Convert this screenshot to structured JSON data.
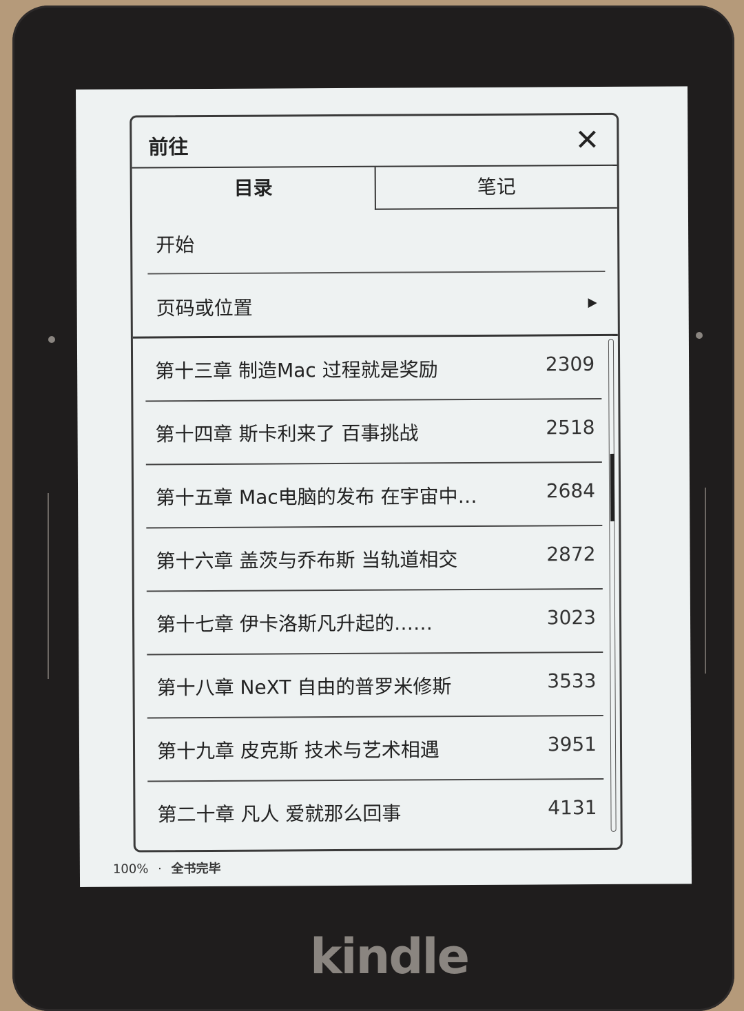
{
  "device": {
    "logo": "kindle"
  },
  "dialog": {
    "title": "前往",
    "close_icon": "close-icon"
  },
  "tabs": [
    {
      "label": "目录",
      "active": true
    },
    {
      "label": "笔记",
      "active": false
    }
  ],
  "menu": {
    "start": "开始",
    "page_or_location": "页码或位置"
  },
  "toc": [
    {
      "title": "第十三章 制造Mac 过程就是奖励",
      "page": "2309"
    },
    {
      "title": "第十四章 斯卡利来了 百事挑战",
      "page": "2518"
    },
    {
      "title": "第十五章 Mac电脑的发布 在宇宙中…",
      "page": "2684"
    },
    {
      "title": "第十六章 盖茨与乔布斯 当轨道相交",
      "page": "2872"
    },
    {
      "title": "第十七章 伊卡洛斯凡升起的……",
      "page": "3023"
    },
    {
      "title": "第十八章 NeXT 自由的普罗米修斯",
      "page": "3533"
    },
    {
      "title": "第十九章 皮克斯 技术与艺术相遇",
      "page": "3951"
    },
    {
      "title": "第二十章 凡人 爱就那么回事",
      "page": "4131"
    }
  ],
  "scroll": {
    "position_fraction": 0.27
  },
  "footer": {
    "progress": "100%",
    "separator": "·",
    "status": "全书完毕"
  }
}
